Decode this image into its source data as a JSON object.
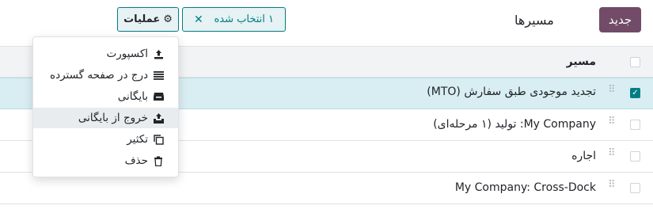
{
  "header": {
    "new_label": "جدید",
    "title": "مسیرها",
    "selection_label": "۱ انتخاب شده",
    "actions_label": "عملیات"
  },
  "table": {
    "column_header": "مسیر",
    "rows": [
      {
        "name": "تجدید موجودی طبق سفارش (MTO)",
        "selected": true
      },
      {
        "name": "My Company: تولید (۱ مرحله‌ای)",
        "selected": false
      },
      {
        "name": "اجاره",
        "selected": false
      },
      {
        "name": "My Company: Cross-Dock",
        "selected": false
      }
    ]
  },
  "actions_menu": {
    "items": [
      {
        "label": "اکسپورت",
        "icon": "upload-icon"
      },
      {
        "label": "درج در صفحه گسترده",
        "icon": "list-icon"
      },
      {
        "label": "بایگانی",
        "icon": "archive-icon"
      },
      {
        "label": "خروج از بایگانی",
        "icon": "unarchive-icon"
      },
      {
        "label": "تکثیر",
        "icon": "copy-icon"
      },
      {
        "label": "حذف",
        "icon": "trash-icon"
      }
    ]
  },
  "colors": {
    "brand": "#714B67",
    "accent": "#017E84",
    "selected_row": "#d9eef2"
  }
}
